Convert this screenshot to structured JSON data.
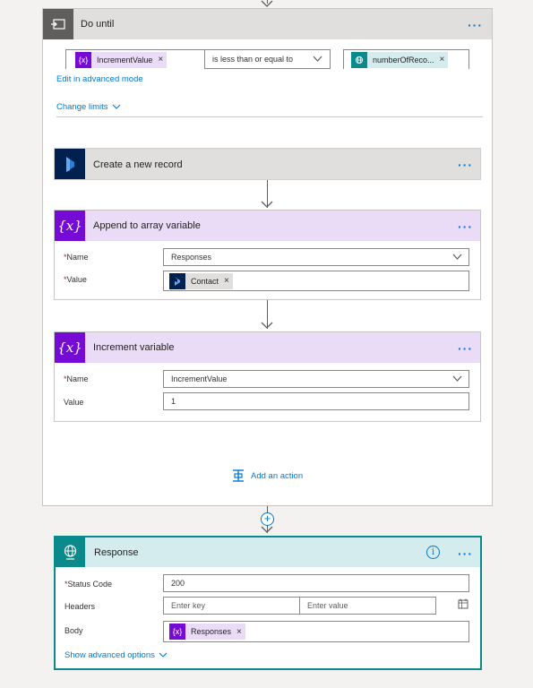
{
  "do_until": {
    "title": "Do until",
    "condition": {
      "left_token": "IncrementValue",
      "operator": "is less than or equal to",
      "right_token": "numberOfReco..."
    },
    "edit_advanced_link": "Edit in advanced mode",
    "change_limits_link": "Change limits"
  },
  "create_record": {
    "title": "Create a new record"
  },
  "append_array": {
    "title": "Append to array variable",
    "name_label": "Name",
    "name_value": "Responses",
    "value_label": "Value",
    "value_token": "Contact"
  },
  "increment": {
    "title": "Increment variable",
    "name_label": "Name",
    "name_value": "IncrementValue",
    "value_label": "Value",
    "value_value": "1"
  },
  "add_action_label": "Add an action",
  "response": {
    "title": "Response",
    "status_code_label": "Status Code",
    "status_code_value": "200",
    "headers_label": "Headers",
    "header_key_placeholder": "Enter key",
    "header_value_placeholder": "Enter value",
    "body_label": "Body",
    "body_token": "Responses",
    "show_advanced_link": "Show advanced options"
  },
  "required_mark": "*",
  "remove_glyph": "×",
  "colors": {
    "variable_purple": "#770bd6",
    "variable_light": "#eadbf7",
    "dynamics_navy": "#002050",
    "response_teal": "#0a8a8a",
    "response_light": "#d4ecee",
    "link_blue": "#0078d4"
  }
}
